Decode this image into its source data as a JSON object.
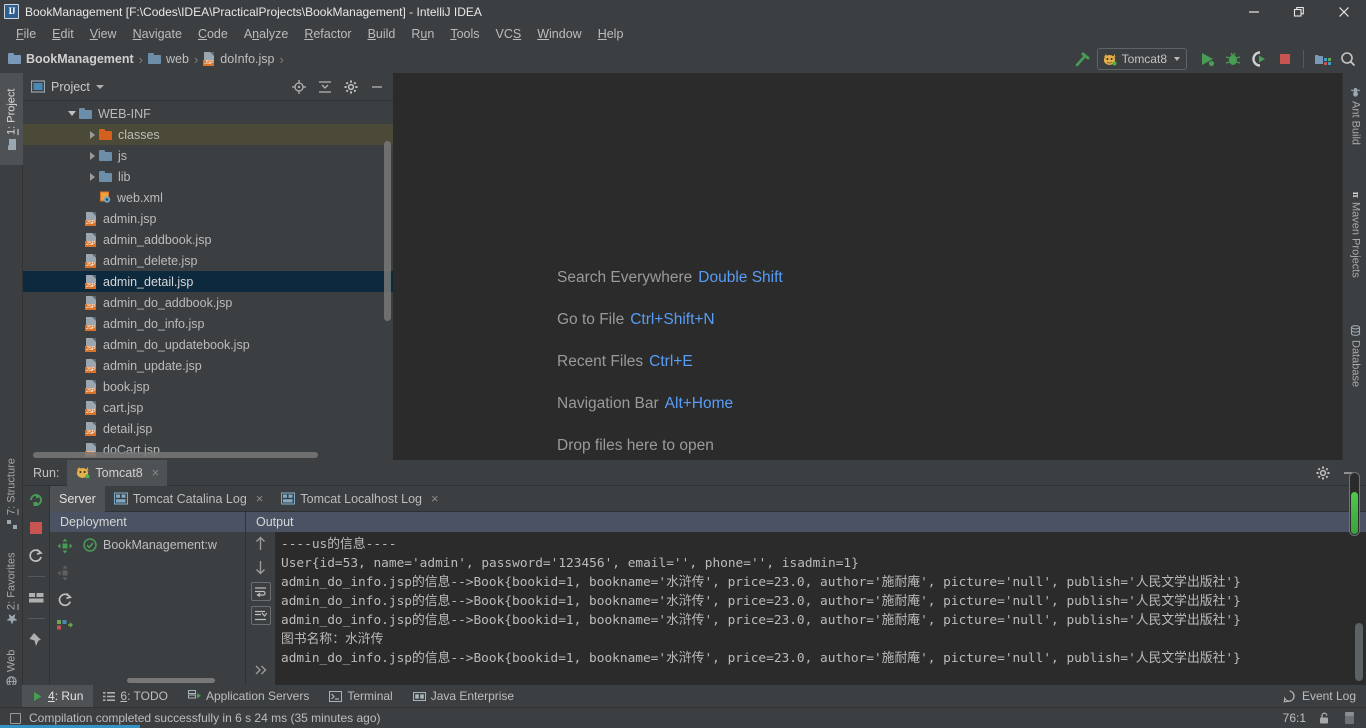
{
  "window": {
    "title": "BookManagement [F:\\Codes\\IDEA\\PracticalProjects\\BookManagement] - IntelliJ IDEA",
    "app_icon": "IJ",
    "minimize": "minimize-icon",
    "maximize": "restore-icon",
    "close": "close-icon"
  },
  "menubar": {
    "items": [
      {
        "pre": "F",
        "rest": "ile"
      },
      {
        "pre": "E",
        "rest": "dit"
      },
      {
        "pre": "V",
        "rest": "iew"
      },
      {
        "pre": "N",
        "rest": "avigate"
      },
      {
        "pre": "C",
        "rest": "ode"
      },
      {
        "pre": "A",
        "rest": "nalyze"
      },
      {
        "pre": "R",
        "rest": "efactor"
      },
      {
        "pre": "B",
        "rest": "uild"
      },
      {
        "pre": "R",
        "rest": "un",
        "mid": "u"
      },
      {
        "pre": "T",
        "rest": "ools"
      },
      {
        "pre": "VCS",
        "rest": ""
      },
      {
        "pre": "W",
        "rest": "indow"
      },
      {
        "pre": "H",
        "rest": "elp"
      }
    ]
  },
  "navbar": {
    "crumbs": [
      {
        "label": "BookManagement",
        "icon": "module-folder-icon"
      },
      {
        "label": "web",
        "icon": "folder-icon"
      },
      {
        "label": "doInfo.jsp",
        "icon": "jsp-file-icon"
      }
    ],
    "separator": "›",
    "run_config": "Tomcat8",
    "run_config_icon": "tomcat-cat-icon",
    "actions": [
      "build-hammer-icon",
      "run-icon",
      "debug-icon",
      "run-coverage-icon",
      "stop-icon",
      "project-structure-icon",
      "search-icon"
    ]
  },
  "left_rail": {
    "top": [
      {
        "num": "1",
        "label": ": Project",
        "icon": "project-folder-icon",
        "active": true
      }
    ],
    "bottom": [
      {
        "num": "7",
        "label": ": Structure",
        "icon": "structure-icon"
      },
      {
        "num": "2",
        "label": ": Favorites",
        "icon": "star-icon"
      },
      {
        "num": "",
        "label": "Web",
        "icon": "web-globe-icon"
      }
    ]
  },
  "right_rail": {
    "items": [
      {
        "label": "Ant Build",
        "icon": "ant-icon"
      },
      {
        "label": "Maven Projects",
        "icon": "maven-m-icon"
      },
      {
        "label": "Database",
        "icon": "database-icon"
      }
    ]
  },
  "project_panel": {
    "title": "Project",
    "actions": [
      "locate-target-icon",
      "collapse-all-icon",
      "settings-gear-icon",
      "hide-minimize-icon"
    ],
    "tree": [
      {
        "label": "WEB-INF",
        "indent": 2,
        "arrow": "down",
        "icon": "folder-icon",
        "state": "normal"
      },
      {
        "label": "classes",
        "indent": 3,
        "arrow": "right",
        "icon": "folder-orange-icon",
        "state": "highlight"
      },
      {
        "label": "js",
        "indent": 3,
        "arrow": "right",
        "icon": "folder-icon",
        "state": "normal"
      },
      {
        "label": "lib",
        "indent": 3,
        "arrow": "right",
        "icon": "folder-icon",
        "state": "normal"
      },
      {
        "label": "web.xml",
        "indent": 4,
        "arrow": "none",
        "icon": "xml-file-icon",
        "state": "normal"
      },
      {
        "label": "admin.jsp",
        "indent": 3,
        "arrow": "none",
        "icon": "jsp-file-icon",
        "state": "normal"
      },
      {
        "label": "admin_addbook.jsp",
        "indent": 3,
        "arrow": "none",
        "icon": "jsp-file-icon",
        "state": "normal"
      },
      {
        "label": "admin_delete.jsp",
        "indent": 3,
        "arrow": "none",
        "icon": "jsp-file-icon",
        "state": "normal"
      },
      {
        "label": "admin_detail.jsp",
        "indent": 3,
        "arrow": "none",
        "icon": "jsp-file-icon",
        "state": "selected"
      },
      {
        "label": "admin_do_addbook.jsp",
        "indent": 3,
        "arrow": "none",
        "icon": "jsp-file-icon",
        "state": "normal"
      },
      {
        "label": "admin_do_info.jsp",
        "indent": 3,
        "arrow": "none",
        "icon": "jsp-file-icon",
        "state": "normal"
      },
      {
        "label": "admin_do_updatebook.jsp",
        "indent": 3,
        "arrow": "none",
        "icon": "jsp-file-icon",
        "state": "normal"
      },
      {
        "label": "admin_update.jsp",
        "indent": 3,
        "arrow": "none",
        "icon": "jsp-file-icon",
        "state": "normal"
      },
      {
        "label": "book.jsp",
        "indent": 3,
        "arrow": "none",
        "icon": "jsp-file-icon",
        "state": "normal"
      },
      {
        "label": "cart.jsp",
        "indent": 3,
        "arrow": "none",
        "icon": "jsp-file-icon",
        "state": "normal"
      },
      {
        "label": "detail.jsp",
        "indent": 3,
        "arrow": "none",
        "icon": "jsp-file-icon",
        "state": "normal"
      },
      {
        "label": "doCart.jsp",
        "indent": 3,
        "arrow": "none",
        "icon": "jsp-file-icon",
        "state": "normal"
      }
    ]
  },
  "editor": {
    "tips": [
      {
        "action": "Search Everywhere",
        "key": "Double Shift"
      },
      {
        "action": "Go to File",
        "key": "Ctrl+Shift+N"
      },
      {
        "action": "Recent Files",
        "key": "Ctrl+E"
      },
      {
        "action": "Navigation Bar",
        "key": "Alt+Home"
      },
      {
        "action": "Drop files here to open",
        "key": ""
      }
    ]
  },
  "run_window": {
    "label": "Run:",
    "tab": "Tomcat8",
    "tab_icon": "tomcat-cat-icon",
    "tab_close": "×",
    "header_actions": [
      "settings-gear-icon",
      "hide-minimize-icon"
    ],
    "side_actions": [
      "rerun-icon",
      "stop-red-icon",
      "restart-icon",
      "layout-icon",
      "pin-icon"
    ],
    "subtabs": [
      {
        "label": "Server",
        "icon": "",
        "active": true,
        "closable": false
      },
      {
        "label": "Tomcat Catalina Log",
        "icon": "log-file-icon",
        "active": false,
        "closable": true
      },
      {
        "label": "Tomcat Localhost Log",
        "icon": "log-file-icon",
        "active": false,
        "closable": true
      }
    ],
    "deployment": {
      "header": "Deployment",
      "tools": [
        "deploy-move-icon",
        "undeploy-icon",
        "redeploy-icon",
        "artifact-icon"
      ],
      "items": [
        {
          "label": "BookManagement:w",
          "icon": "status-ok-icon"
        }
      ]
    },
    "output": {
      "header": "Output",
      "gutter_actions": [
        "scroll-up-icon",
        "scroll-down-icon",
        "soft-wrap-icon",
        "scroll-to-end-icon",
        "expand-more-icon"
      ],
      "lines": [
        "----us的信息----",
        "User{id=53, name='admin', password='123456', email='', phone='', isadmin=1}",
        "admin_do_info.jsp的信息-->Book{bookid=1, bookname='水浒传', price=23.0, author='施耐庵', picture='null', publish='人民文学出版社'}",
        "admin_do_info.jsp的信息-->Book{bookid=1, bookname='水浒传', price=23.0, author='施耐庵', picture='null', publish='人民文学出版社'}",
        "admin_do_info.jsp的信息-->Book{bookid=1, bookname='水浒传', price=23.0, author='施耐庵', picture='null', publish='人民文学出版社'}",
        "图书名称：水浒传",
        "admin_do_info.jsp的信息-->Book{bookid=1, bookname='水浒传', price=23.0, author='施耐庵', picture='null', publish='人民文学出版社'}"
      ]
    }
  },
  "bottom_tabs": {
    "items": [
      {
        "num": "4",
        "label": ": Run",
        "icon": "run-play-icon",
        "active": true
      },
      {
        "num": "6",
        "label": ": TODO",
        "icon": "todo-list-icon",
        "active": false
      },
      {
        "num": "",
        "label": "Application Servers",
        "icon": "app-servers-icon",
        "active": false
      },
      {
        "num": "",
        "label": "Terminal",
        "icon": "terminal-icon",
        "active": false
      },
      {
        "num": "",
        "label": "Java Enterprise",
        "icon": "java-ee-icon",
        "active": false
      }
    ],
    "event_log": "Event Log",
    "event_log_icon": "event-log-icon"
  },
  "statusbar": {
    "icon": "status-square-icon",
    "message": "Compilation completed successfully in 6 s 24 ms (35 minutes ago)",
    "caret_position": "76:1",
    "lock_icon": "lock-icon",
    "memory_icon": "memory-indicator-icon"
  },
  "colors": {
    "accent_blue": "#589df6",
    "selection": "#0d293e",
    "panel_bg": "#3c3f41",
    "editor_bg": "#2b2b2b",
    "header_blue": "#4b5263",
    "progress_green": "#4ec94e"
  }
}
